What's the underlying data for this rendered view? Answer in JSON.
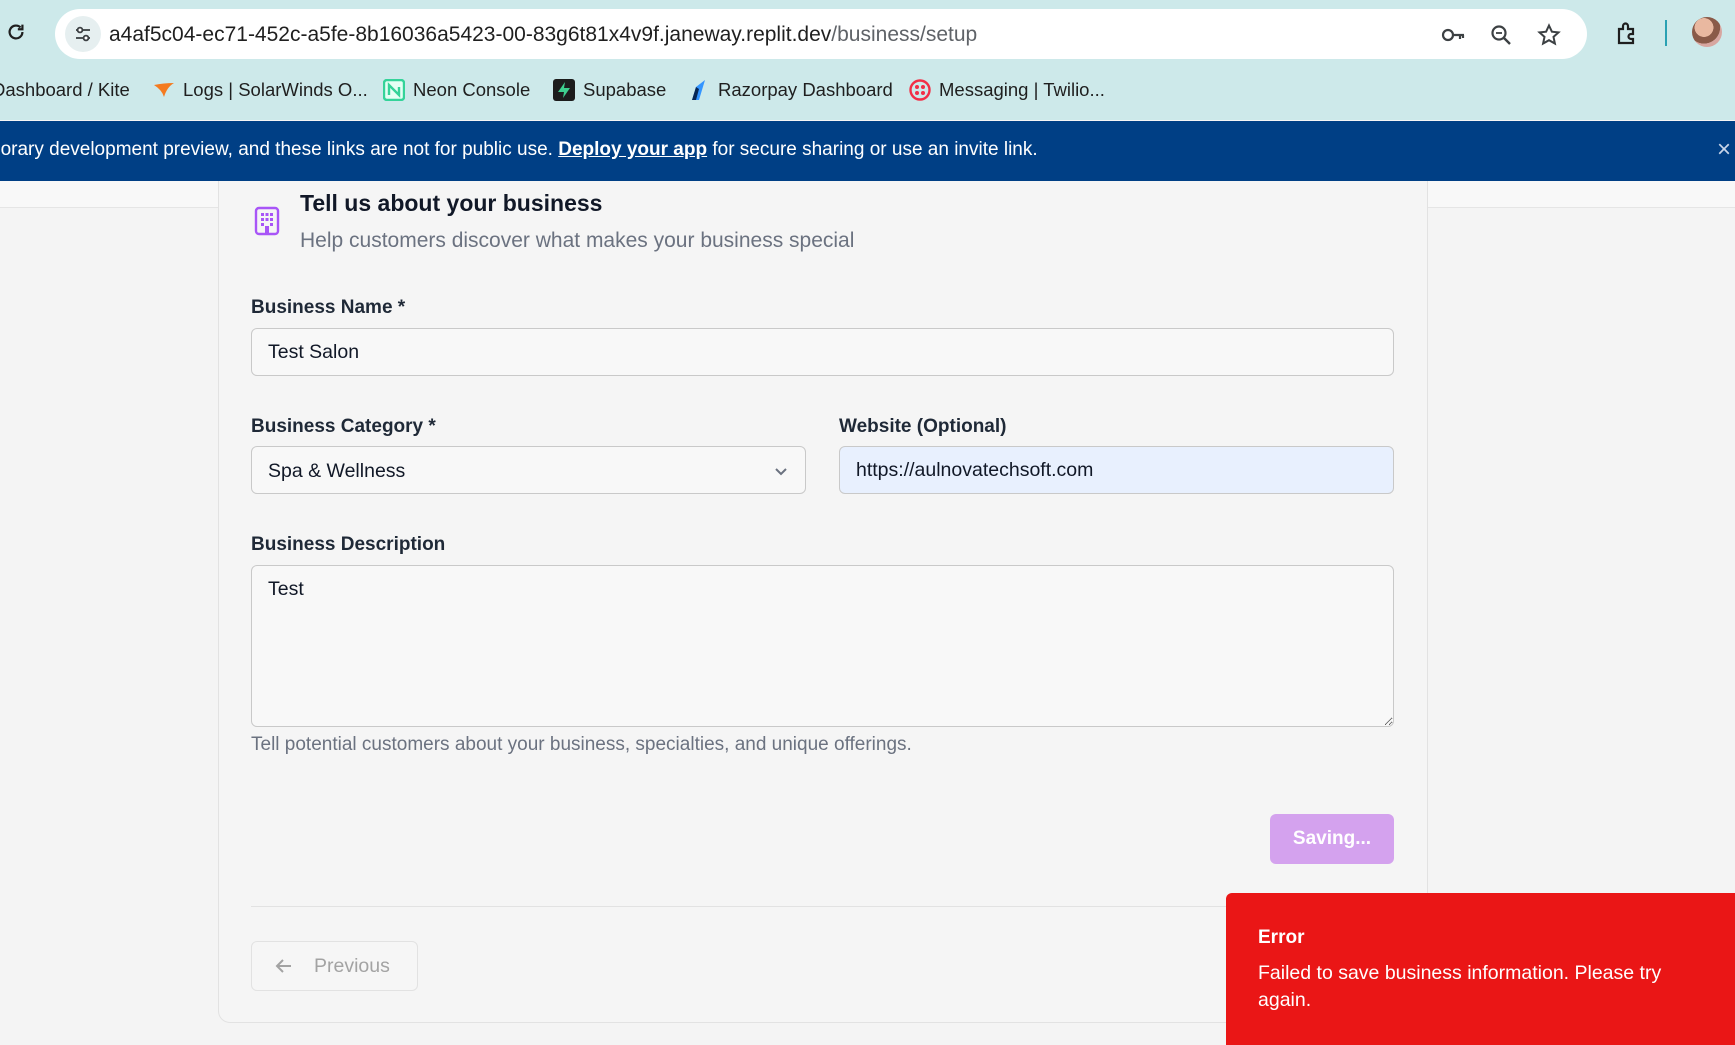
{
  "browser": {
    "url_host": "a4af5c04-ec71-452c-a5fe-8b16036a5423-00-83g6t81x4v9f.janeway.replit.dev",
    "url_path": "/business/setup",
    "bookmarks": [
      {
        "label": "Dashboard / Kite",
        "icon": "kite-icon"
      },
      {
        "label": "Logs | SolarWinds O...",
        "icon": "solarwinds-icon"
      },
      {
        "label": "Neon Console",
        "icon": "neon-icon"
      },
      {
        "label": "Supabase",
        "icon": "supabase-icon"
      },
      {
        "label": "Razorpay Dashboard",
        "icon": "razorpay-icon"
      },
      {
        "label": "Messaging | Twilio...",
        "icon": "twilio-icon"
      }
    ]
  },
  "banner": {
    "text_before": "porary development preview, and these links are not for public use. ",
    "link": "Deploy your app",
    "text_after": " for secure sharing or use an invite link.",
    "close": "×"
  },
  "section": {
    "title": "Tell us about your business",
    "subtitle": "Help customers discover what makes your business special"
  },
  "form": {
    "name_label": "Business Name *",
    "name_value": "Test Salon",
    "category_label": "Business Category *",
    "category_value": "Spa & Wellness",
    "website_label": "Website (Optional)",
    "website_value": "https://aulnovatechsoft.com",
    "description_label": "Business Description",
    "description_value": "Test",
    "description_help": "Tell potential customers about your business, specialties, and unique offerings.",
    "save_label": "Saving...",
    "previous_label": "Previous"
  },
  "toast": {
    "title": "Error",
    "message": "Failed to save business information. Please try again."
  },
  "colors": {
    "chrome_bg": "#cde9ea",
    "banner_bg": "#003f85",
    "accent_purple": "#d4a2ee",
    "toast_red": "#ea1616"
  }
}
